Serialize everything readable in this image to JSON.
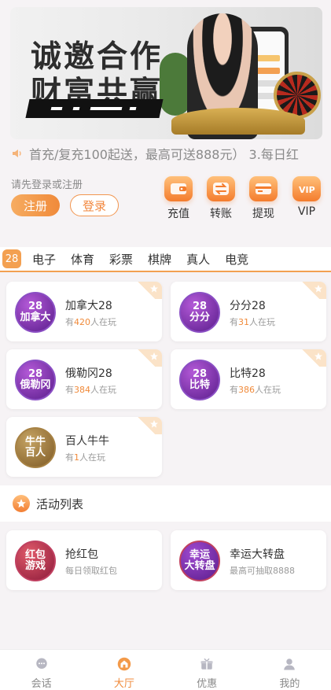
{
  "banner": {
    "line1": "诚邀合作",
    "line2": "财富共赢"
  },
  "notice": {
    "text": "首充/复充100起送，最高可送888元） 3.每日红"
  },
  "account": {
    "login_tip": "请先登录或注册",
    "register_label": "注册",
    "login_label": "登录"
  },
  "quick_actions": [
    {
      "label": "充值",
      "icon": "wallet-icon"
    },
    {
      "label": "转账",
      "icon": "transfer-icon"
    },
    {
      "label": "提现",
      "icon": "card-icon"
    },
    {
      "label": "VIP",
      "icon": "vip-icon"
    }
  ],
  "categories": {
    "active": "28",
    "items": [
      "电子",
      "体育",
      "彩票",
      "棋牌",
      "真人",
      "电竞"
    ]
  },
  "games": [
    {
      "logo": "28\n加拿大",
      "name": "加拿大28",
      "pre": "有",
      "count": "420",
      "post": "人在玩"
    },
    {
      "logo": "28\n分分",
      "name": "分分28",
      "pre": "有",
      "count": "31",
      "post": "人在玩"
    },
    {
      "logo": "28\n俄勒冈",
      "name": "俄勒冈28",
      "pre": "有",
      "count": "384",
      "post": "人在玩"
    },
    {
      "logo": "28\n比特",
      "name": "比特28",
      "pre": "有",
      "count": "386",
      "post": "人在玩"
    },
    {
      "logo": "牛牛\n百人",
      "name": "百人牛牛",
      "pre": "有",
      "count": "1",
      "post": "人在玩"
    }
  ],
  "activities": {
    "title": "活动列表",
    "items": [
      {
        "logo": "红包\n游戏",
        "name": "抢红包",
        "desc": "每日领取红包"
      },
      {
        "logo": "幸运\n大转盘",
        "name": "幸运大转盘",
        "desc": "最高可抽取8888"
      }
    ]
  },
  "tabbar": [
    {
      "label": "会话",
      "icon": "chat-icon"
    },
    {
      "label": "大厅",
      "icon": "lobby-icon",
      "active": true
    },
    {
      "label": "优惠",
      "icon": "gift-icon"
    },
    {
      "label": "我的",
      "icon": "user-icon"
    }
  ],
  "colors": {
    "accent": "#f08a3a",
    "accent_light": "#f6ac61",
    "background": "#f6f3f5"
  }
}
